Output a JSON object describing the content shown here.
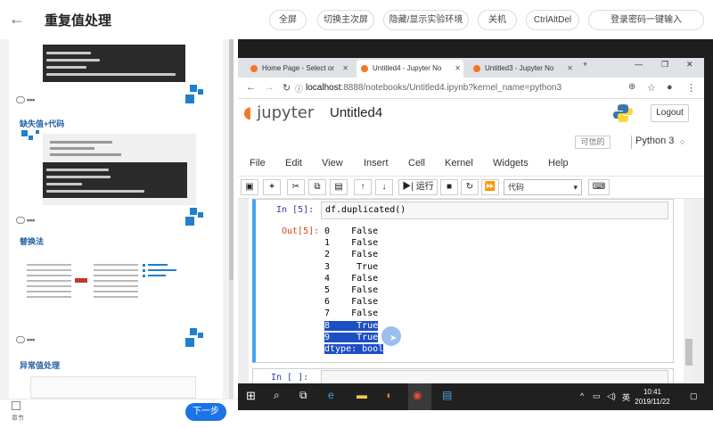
{
  "header": {
    "title": "重复值处理",
    "buttons": [
      "全屏",
      "切换主次屏",
      "隐藏/显示实验环境",
      "关机",
      "CtrlAltDel",
      "登录密码一键输入"
    ]
  },
  "sidebar": {
    "section_missing": "缺失值+代码",
    "section_replace": "替换法",
    "section_outlier": "异常值处理",
    "chapter_label": "章节",
    "next_label": "下一步"
  },
  "browser": {
    "tabs": [
      {
        "label": "Home Page - Select or"
      },
      {
        "label": "Untitled4 - Jupyter No"
      },
      {
        "label": "Untitled3 - Jupyter No"
      }
    ],
    "url_host": "localhost",
    "url_path": ":8888/notebooks/Untitled4.ipynb?kernel_name=python3"
  },
  "jupyter": {
    "logo_text": "jupyter",
    "notebook_name": "Untitled4",
    "logout": "Logout",
    "trusted": "可信的",
    "kernel_name": "Python 3",
    "menu": [
      "File",
      "Edit",
      "View",
      "Insert",
      "Cell",
      "Kernel",
      "Widgets",
      "Help"
    ],
    "run_label": "运行",
    "cell_type": "代码",
    "cell1": {
      "in_prompt": "In  [5]:",
      "code": "df.duplicated()",
      "out_prompt": "Out[5]:",
      "output": [
        {
          "idx": "0",
          "val": "False",
          "hl": false
        },
        {
          "idx": "1",
          "val": "False",
          "hl": false
        },
        {
          "idx": "2",
          "val": "False",
          "hl": false
        },
        {
          "idx": "3",
          "val": " True",
          "hl": false
        },
        {
          "idx": "4",
          "val": "False",
          "hl": false
        },
        {
          "idx": "5",
          "val": "False",
          "hl": false
        },
        {
          "idx": "6",
          "val": "False",
          "hl": false
        },
        {
          "idx": "7",
          "val": "False",
          "hl": false
        },
        {
          "idx": "8",
          "val": " True",
          "hl": true
        },
        {
          "idx": "9",
          "val": " True",
          "hl": true
        }
      ],
      "dtype": "dtype: bool"
    },
    "cell2": {
      "in_prompt": "In  [ ]:"
    }
  },
  "taskbar": {
    "lang": "英",
    "time": "10:41",
    "date": "2019/11/22"
  }
}
